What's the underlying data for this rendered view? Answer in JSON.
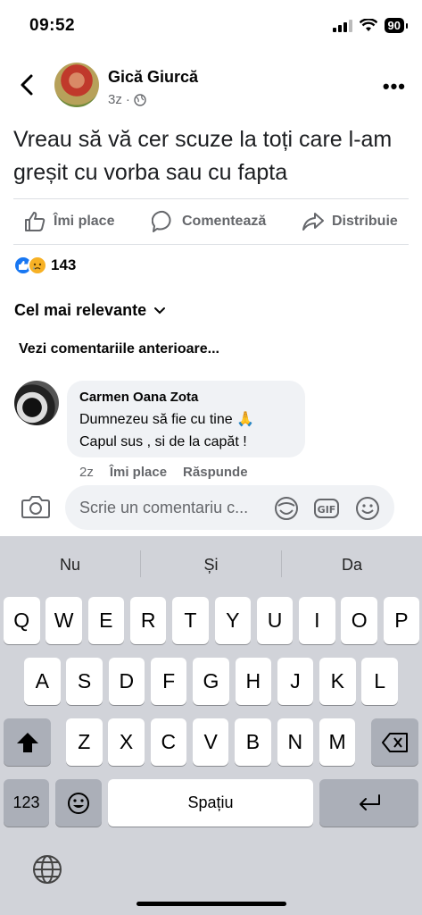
{
  "status_bar": {
    "time": "09:52",
    "battery": "90"
  },
  "post": {
    "author": "Gică Giurcă",
    "time": "3z",
    "text": "Vreau să vă cer scuze la toți care l-am greșit cu vorba sau cu fapta",
    "actions": {
      "like": "Îmi place",
      "comment": "Comentează",
      "share": "Distribuie"
    },
    "reactions": {
      "count": "143"
    }
  },
  "comments": {
    "sort_label": "Cel mai relevante",
    "previous_label": "Vezi comentariile anterioare...",
    "items": [
      {
        "author": "Carmen Oana Zota",
        "line1": "Dumnezeu să fie cu tine 🙏",
        "line2": "Capul sus , si de la capăt !",
        "time": "2z",
        "like": "Îmi place",
        "reply": "Răspunde"
      }
    ]
  },
  "composer": {
    "placeholder": "Scrie un comentariu c..."
  },
  "keyboard": {
    "suggestions": [
      "Nu",
      "Și",
      "Da"
    ],
    "row1": [
      "Q",
      "W",
      "E",
      "R",
      "T",
      "Y",
      "U",
      "I",
      "O",
      "P"
    ],
    "row2": [
      "A",
      "S",
      "D",
      "F",
      "G",
      "H",
      "J",
      "K",
      "L"
    ],
    "row3": [
      "Z",
      "X",
      "C",
      "V",
      "B",
      "N",
      "M"
    ],
    "numbers_label": "123",
    "space_label": "Spațiu"
  }
}
